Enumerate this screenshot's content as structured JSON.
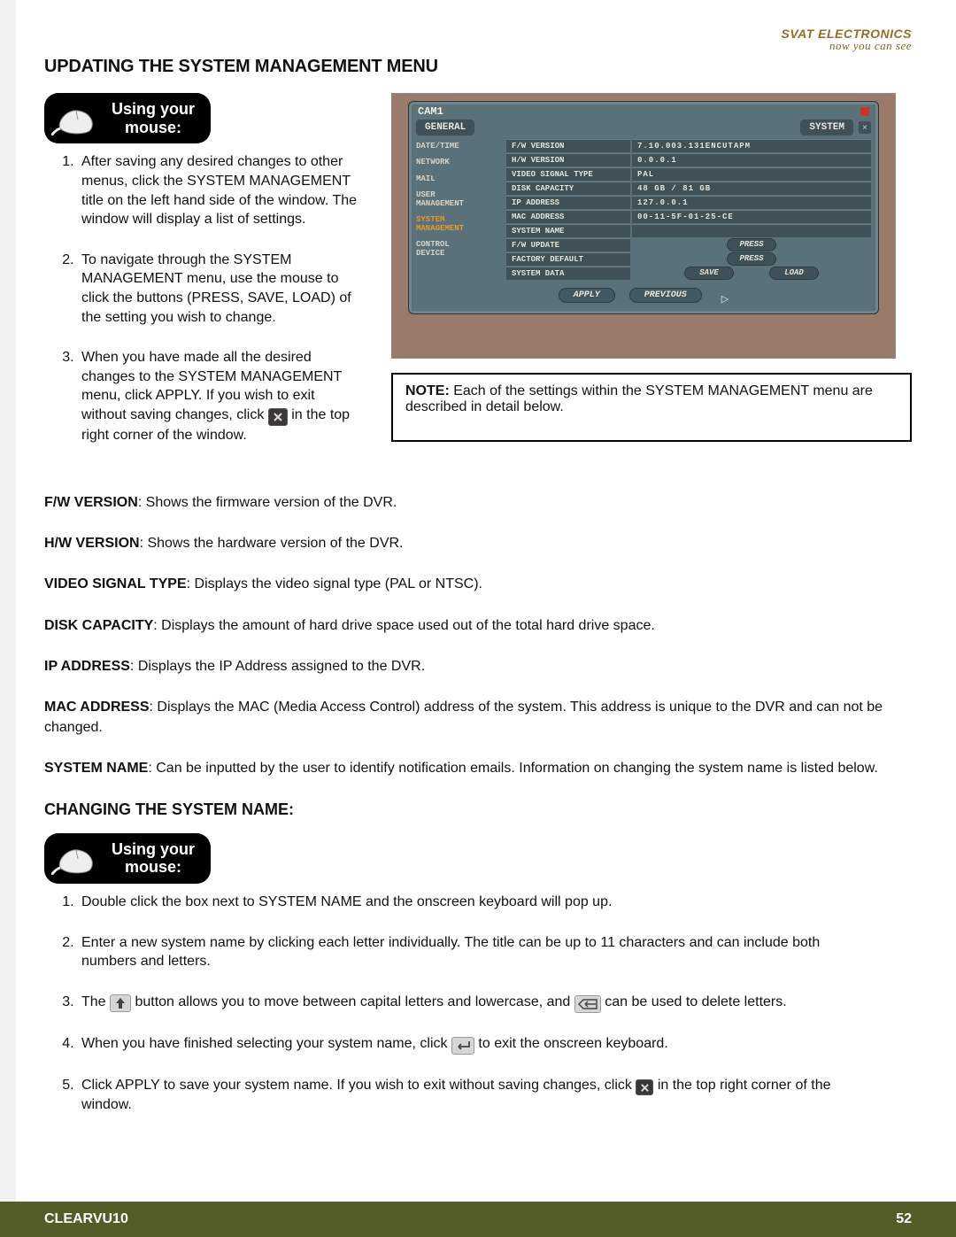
{
  "brand": {
    "name": "SVAT ELECTRONICS",
    "tagline": "now you can see"
  },
  "section1_title": "UPDATING THE SYSTEM MANAGEMENT MENU",
  "mouse_badge": {
    "line1": "Using your",
    "line2": "mouse:"
  },
  "steps1": {
    "s1": "After saving any desired changes to other menus, click the SYSTEM MANAGEMENT title on the left hand side of the window.  The window will display a list of settings.",
    "s2": "To navigate through the SYSTEM MANAGEMENT menu, use the mouse to click the buttons (PRESS, SAVE, LOAD) of the setting you wish to change.",
    "s3a": "When you have made all the desired changes to the SYSTEM MANAGEMENT menu, click APPLY.  If you wish to exit without saving changes, click ",
    "s3b": " in the top right corner of the window."
  },
  "screenshot": {
    "cam": "CAM1",
    "tab_left": "GENERAL",
    "tab_right": "SYSTEM",
    "sidebar": [
      "DATE/TIME",
      "NETWORK",
      "MAIL",
      "USER\nMANAGEMENT",
      "SYSTEM\nMANAGEMENT",
      "CONTROL\nDEVICE"
    ],
    "rows": [
      {
        "label": "F/W VERSION",
        "value": "7.10.003.131ENCUTAPM"
      },
      {
        "label": "H/W VERSION",
        "value": "0.0.0.1"
      },
      {
        "label": "VIDEO SIGNAL TYPE",
        "value": "PAL"
      },
      {
        "label": "DISK CAPACITY",
        "value": "48 GB / 81 GB"
      },
      {
        "label": "IP ADDRESS",
        "value": "127.0.0.1"
      },
      {
        "label": "MAC ADDRESS",
        "value": "00-11-5F-01-25-CE"
      },
      {
        "label": "SYSTEM NAME",
        "value": ""
      },
      {
        "label": "F/W UPDATE",
        "btns": [
          "PRESS"
        ]
      },
      {
        "label": "FACTORY DEFAULT",
        "btns": [
          "PRESS"
        ]
      },
      {
        "label": "SYSTEM DATA",
        "btns": [
          "SAVE",
          "LOAD"
        ]
      }
    ],
    "actions": [
      "APPLY",
      "PREVIOUS"
    ]
  },
  "note": {
    "label": "NOTE:",
    "text": "Each of the settings within the SYSTEM MANAGEMENT menu are described in detail below."
  },
  "definitions": [
    {
      "term": "F/W VERSION",
      "desc": ":  Shows the firmware version of the DVR."
    },
    {
      "term": "H/W VERSION",
      "desc": ":  Shows the hardware version of the DVR."
    },
    {
      "term": "VIDEO SIGNAL TYPE",
      "desc": ":  Displays the video signal type (PAL or NTSC)."
    },
    {
      "term": "DISK CAPACITY",
      "desc": ":  Displays the amount of hard drive space used out of the total hard drive space."
    },
    {
      "term": "IP ADDRESS",
      "desc": ":  Displays the IP Address assigned to the DVR."
    },
    {
      "term": "MAC ADDRESS",
      "desc": ":  Displays the MAC (Media Access Control) address of the system.  This address is unique to the DVR and can not be changed."
    },
    {
      "term": "SYSTEM NAME",
      "desc": ":  Can be inputted by the user to identify notification emails.  Information on changing the system name is listed below."
    }
  ],
  "section2_title": "CHANGING THE SYSTEM NAME:",
  "steps2": {
    "s1": "Double click the box next to SYSTEM NAME and the onscreen keyboard will pop up.",
    "s2": "Enter a new system name by clicking each letter individually.  The title can be up to 11 characters and can include both numbers and letters.",
    "s3a": "The ",
    "s3b": " button allows you to move between capital letters and lowercase, and ",
    "s3c": " can be used to delete letters.",
    "s4a": "When you have finished selecting your system name, click ",
    "s4b": " to exit the onscreen keyboard.",
    "s5a": "Click APPLY to save your system name.  If you wish to exit without saving changes, click ",
    "s5b": " in the top right corner of the window."
  },
  "footer": {
    "model": "CLEARVU10",
    "page": "52"
  }
}
